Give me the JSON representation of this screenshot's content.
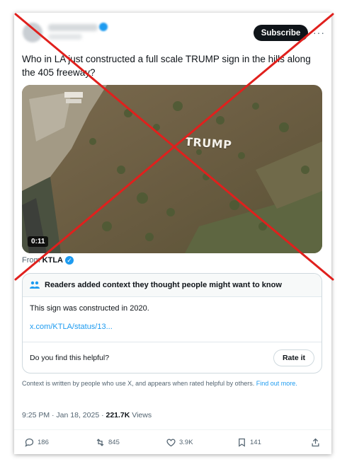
{
  "post": {
    "subscribe_label": "Subscribe",
    "more_label": "···",
    "text": "Who in LA just constructed a full scale TRUMP sign in the hills along the 405 freeway?",
    "media": {
      "sign_text": "TRUMP",
      "duration": "0:11"
    },
    "from_prefix": "From",
    "from_source": "KTLA",
    "verified_glyph": "✓"
  },
  "community_note": {
    "header": "Readers added context they thought people might want to know",
    "body": "This sign was constructed in 2020.",
    "link": "x.com/KTLA/status/13...",
    "helpful_question": "Do you find this helpful?",
    "rate_label": "Rate it",
    "disclaimer": "Context is written by people who use X, and appears when rated helpful by others.",
    "find_out_more": "Find out more."
  },
  "meta": {
    "time": "9:25 PM · Jan 18, 2025 · ",
    "views_count": "221.7K",
    "views_label": " Views"
  },
  "actions": {
    "replies": "186",
    "reposts": "845",
    "likes": "3.9K",
    "bookmarks": "141"
  },
  "colors": {
    "accent": "#1d9bf0",
    "cross_out": "#e0201d"
  }
}
